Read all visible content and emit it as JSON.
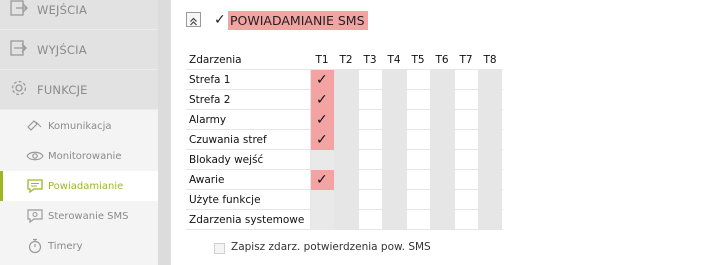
{
  "sidebar": {
    "main_items": [
      {
        "label": "WEJŚCIA",
        "icon": "input-arrow-icon"
      },
      {
        "label": "WYJŚCIA",
        "icon": "output-arrow-icon"
      },
      {
        "label": "FUNKCJE",
        "icon": "gear-icon"
      }
    ],
    "sub_items": [
      {
        "label": "Komunikacja",
        "icon": "communication-icon",
        "active": false
      },
      {
        "label": "Monitorowanie",
        "icon": "eye-icon",
        "active": false
      },
      {
        "label": "Powiadamianie",
        "icon": "chat-bubble-icon",
        "active": true
      },
      {
        "label": "Sterowanie SMS",
        "icon": "sms-control-icon",
        "active": false
      },
      {
        "label": "Timery",
        "icon": "stopwatch-icon",
        "active": false
      }
    ],
    "accent_color": "#9bb822"
  },
  "section": {
    "title": "POWIADAMIANIE SMS",
    "title_bg": "#f4a3a3",
    "enabled": true
  },
  "table": {
    "header": "Zdarzenia",
    "columns": [
      "T1",
      "T2",
      "T3",
      "T4",
      "T5",
      "T6",
      "T7",
      "T8"
    ],
    "rows": [
      {
        "label": "Strefa 1",
        "checked": [
          true,
          false,
          false,
          false,
          false,
          false,
          false,
          false
        ]
      },
      {
        "label": "Strefa 2",
        "checked": [
          true,
          false,
          false,
          false,
          false,
          false,
          false,
          false
        ]
      },
      {
        "label": "Alarmy",
        "checked": [
          true,
          false,
          false,
          false,
          false,
          false,
          false,
          false
        ]
      },
      {
        "label": "Czuwania stref",
        "checked": [
          true,
          false,
          false,
          false,
          false,
          false,
          false,
          false
        ]
      },
      {
        "label": "Blokady wejść",
        "checked": [
          false,
          false,
          false,
          false,
          false,
          false,
          false,
          false
        ]
      },
      {
        "label": "Awarie",
        "checked": [
          true,
          false,
          false,
          false,
          false,
          false,
          false,
          false
        ]
      },
      {
        "label": "Użyte funkcje",
        "checked": [
          false,
          false,
          false,
          false,
          false,
          false,
          false,
          false
        ]
      },
      {
        "label": "Zdarzenia systemowe",
        "checked": [
          false,
          false,
          false,
          false,
          false,
          false,
          false,
          false
        ]
      }
    ]
  },
  "footer": {
    "checkbox_label": "Zapisz zdarz. potwierdzenia pow. SMS",
    "checked": false
  }
}
